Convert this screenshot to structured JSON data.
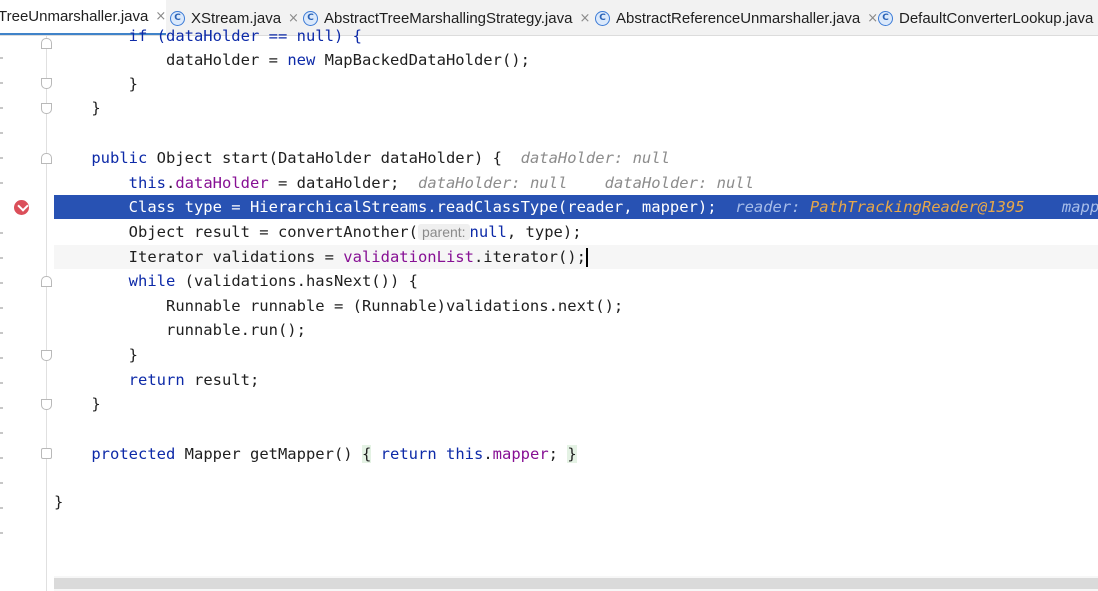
{
  "tabs": [
    {
      "label": "TreeUnmarshaller.java",
      "has_icon": false
    },
    {
      "label": "XStream.java",
      "has_icon": true
    },
    {
      "label": "AbstractTreeMarshallingStrategy.java",
      "has_icon": true
    },
    {
      "label": "AbstractReferenceUnmarshaller.java",
      "has_icon": true
    },
    {
      "label": "DefaultConverterLookup.java",
      "has_icon": true
    }
  ],
  "tab_icon_letter": "C",
  "tab_close": "×",
  "code": {
    "l0": "if (dataHolder == null) {",
    "l1_var": "dataHolder",
    "l1_eq": " = ",
    "l1_kw": "new",
    "l1_rest": " MapBackedDataHolder();",
    "l2": "}",
    "l3": "}",
    "l5_kw": "public",
    "l5_rest": " Object start(DataHolder dataHolder) {",
    "l5_hint": "dataHolder: null",
    "l6_kw": "this",
    "l6_dot": ".",
    "l6_fld": "dataHolder",
    "l6_rest": " = dataHolder;",
    "l6_hint1": "dataHolder: null",
    "l6_hint2": "dataHolder: null",
    "l7_code": "Class type = HierarchicalStreams.readClassType(reader, mapper);",
    "l7_hint_name": "reader:",
    "l7_hint_val": "PathTrackingReader@1395",
    "l7_hint2": "mapper: C",
    "l8_pre": "Object result = convertAnother(",
    "l8_param": "parent:",
    "l8_null": "null",
    "l8_post": ", type);",
    "l9_pre": "Iterator validations = ",
    "l9_fld": "validationList",
    "l9_post": ".iterator();",
    "l10_kw": "while",
    "l10_rest": " (validations.hasNext()) {",
    "l11": "Runnable runnable = (Runnable)validations.next();",
    "l12": "runnable.run();",
    "l13": "}",
    "l14_kw": "return",
    "l14_rest": " result;",
    "l15": "}",
    "l17_kw": "protected",
    "l17_rest": " Mapper getMapper() ",
    "l17_ob": "{",
    "l17_ret": "return",
    "l17_this": "this",
    "l17_fld": "mapper",
    "l17_semi": ";",
    "l17_cb": "}",
    "l19": "}"
  },
  "colors": {
    "keyword": "#0d2aa8",
    "field": "#871094",
    "execution_line": "#2852b3",
    "breakpoint": "#db4f5a",
    "inline_value": "#e6a74a"
  }
}
